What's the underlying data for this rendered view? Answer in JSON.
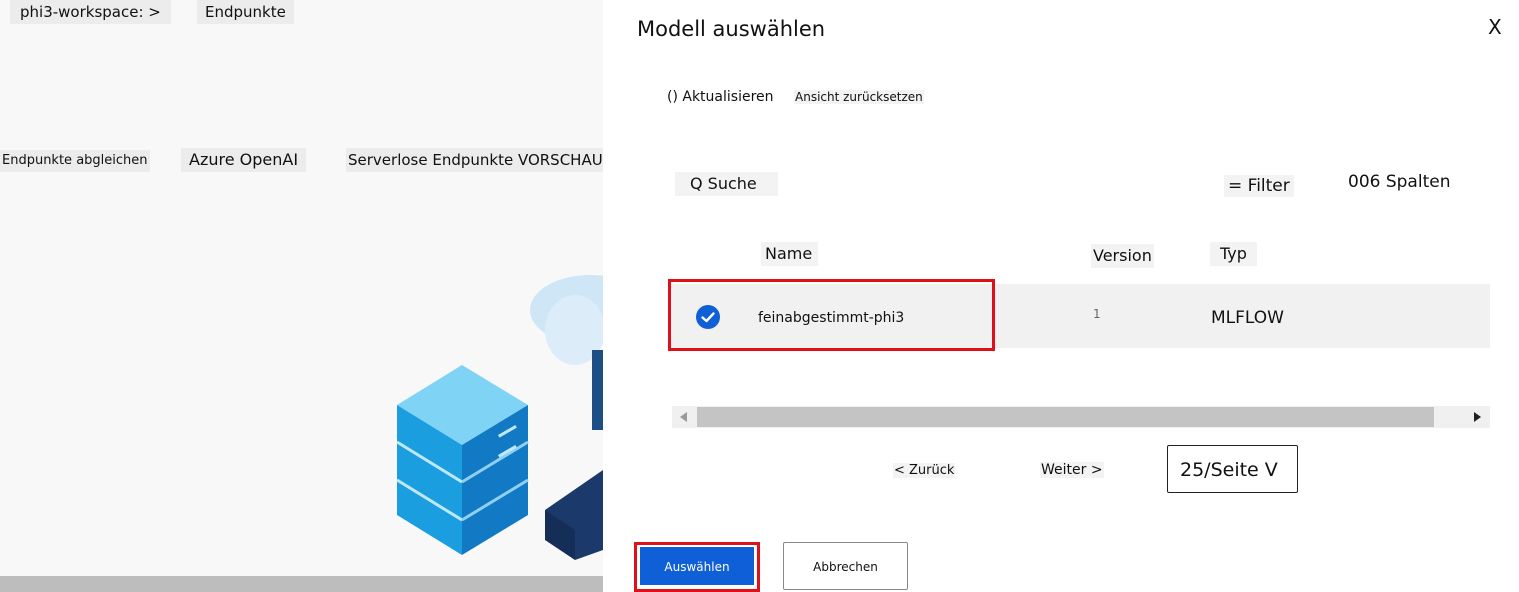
{
  "background": {
    "breadcrumb": {
      "workspace": "phi3-workspace: >",
      "current": "Endpunkte"
    },
    "tabs": [
      "Endpunkte abgleichen",
      "Azure OpenAI",
      "Serverlose Endpunkte VORSCHAU"
    ]
  },
  "dialog": {
    "title": "Modell auswählen",
    "close_label": "X",
    "toolbar": {
      "refresh_label": "() Aktualisieren",
      "reset_view_label": "Ansicht zurücksetzen"
    },
    "search_label": "Q Suche",
    "filter_label": "= Filter",
    "columns_label": "006 Spalten",
    "table": {
      "headers": {
        "name": "Name",
        "version": "Version",
        "type": "Typ"
      },
      "rows": [
        {
          "name": "feinabgestimmt-phi3",
          "version": "1",
          "type": "MLFLOW",
          "selected": true
        }
      ]
    },
    "pagination": {
      "prev_label": "< Zurück",
      "next_label": "Weiter >",
      "page_size_label": "25/Seite V"
    },
    "buttons": {
      "select_label": "Auswählen",
      "cancel_label": "Abbrechen"
    }
  },
  "colors": {
    "accent": "#0f5fd6",
    "highlight": "#e0101b"
  }
}
